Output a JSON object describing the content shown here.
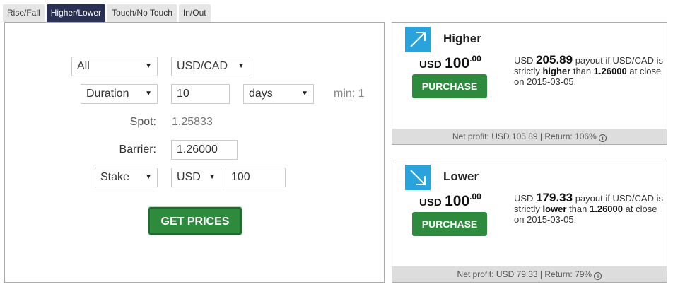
{
  "tabs": [
    "Rise/Fall",
    "Higher/Lower",
    "Touch/No Touch",
    "In/Out"
  ],
  "form": {
    "market": "All",
    "symbol": "USD/CAD",
    "duration_type": "Duration",
    "duration_value": "10",
    "duration_unit": "days",
    "min_label": "min",
    "min_value": "1",
    "spot_label": "Spot:",
    "spot_value": "1.25833",
    "barrier_label": "Barrier:",
    "barrier_value": "1.26000",
    "amount_type": "Stake",
    "currency": "USD",
    "amount": "100",
    "get_prices": "GET PRICES"
  },
  "contracts": [
    {
      "title": "Higher",
      "price_currency": "USD",
      "price_whole": "100",
      "price_decimal": ".00",
      "purchase": "PURCHASE",
      "desc_currency": "USD",
      "payout": "205.89",
      "desc_a": "payout if USD/CAD is strictly",
      "direction": "higher",
      "desc_b": "than",
      "barrier": "1.26000",
      "desc_c": "at close on 2015-03-05.",
      "footer": "Net profit: USD 105.89 | Return: 106%"
    },
    {
      "title": "Lower",
      "price_currency": "USD",
      "price_whole": "100",
      "price_decimal": ".00",
      "purchase": "PURCHASE",
      "desc_currency": "USD",
      "payout": "179.33",
      "desc_a": "payout if USD/CAD is strictly",
      "direction": "lower",
      "desc_b": "than",
      "barrier": "1.26000",
      "desc_c": "at close on 2015-03-05.",
      "footer": "Net profit: USD 79.33 | Return: 79%"
    }
  ],
  "icons": {
    "contract_icon_color": "#2aa3dc",
    "button_color": "#2e8b3e",
    "active_tab_color": "#2a3052"
  }
}
